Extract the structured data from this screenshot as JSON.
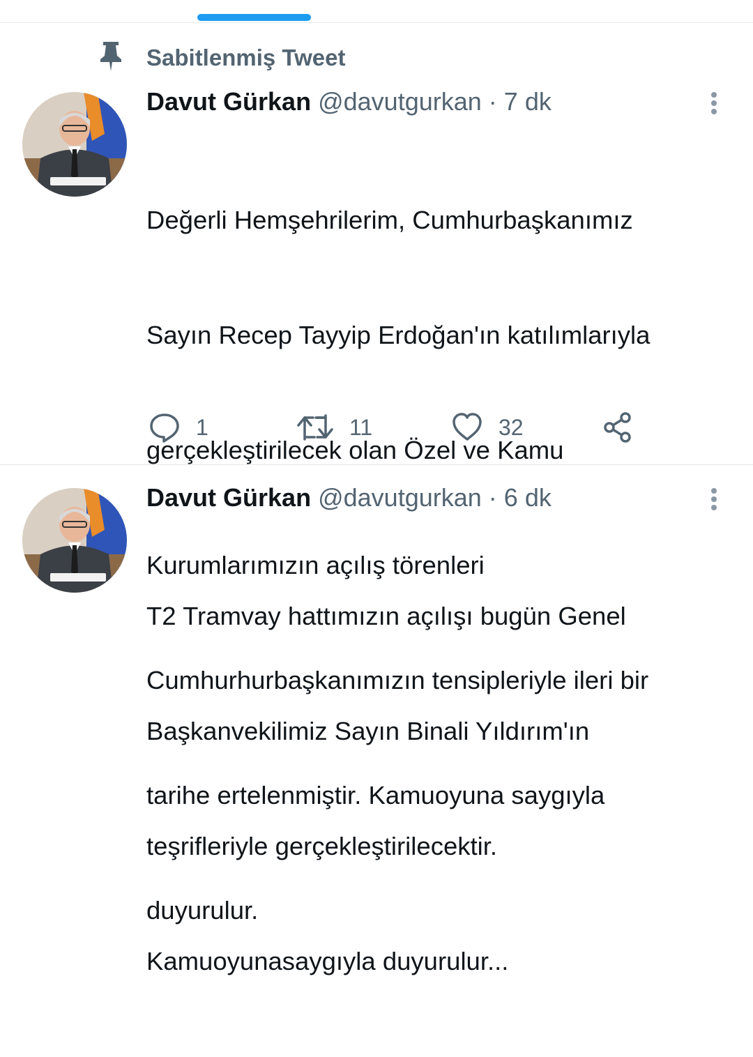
{
  "pinned": {
    "label": "Sabitlenmiş Tweet",
    "icon": "pin-icon"
  },
  "tweets": [
    {
      "display_name": "Davut Gürkan",
      "handle": "@davutgurkan",
      "separator": "·",
      "time": "7 dk",
      "lines": [
        "Değerli Hemşehrilerim, Cumhurbaşkanımız",
        "Sayın Recep Tayyip Erdoğan'ın katılımlarıyla",
        "gerçekleştirilecek olan Özel ve Kamu",
        "Kurumlarımızın açılış törenleri",
        "Cumhurhurbaşkanımızın tensipleriyle ileri bir",
        "tarihe ertelenmiştir. Kamuoyuna saygıyla",
        "duyurulur."
      ],
      "actions": {
        "reply_count": "1",
        "retweet_count": "11",
        "like_count": "32"
      }
    },
    {
      "display_name": "Davut Gürkan",
      "handle": "@davutgurkan",
      "separator": "·",
      "time": "6 dk",
      "lines": [
        "T2 Tramvay hattımızın açılışı bugün Genel",
        "Başkanvekilimiz Sayın Binali Yıldırım'ın",
        "teşrifleriyle gerçekleştirilecektir.",
        "Kamuoyunasaygıyla duyurulur..."
      ]
    }
  ],
  "colors": {
    "accent": "#1d9bf0",
    "text_primary": "#0f1419",
    "text_secondary": "#536471",
    "divider": "#e3e7ea"
  }
}
